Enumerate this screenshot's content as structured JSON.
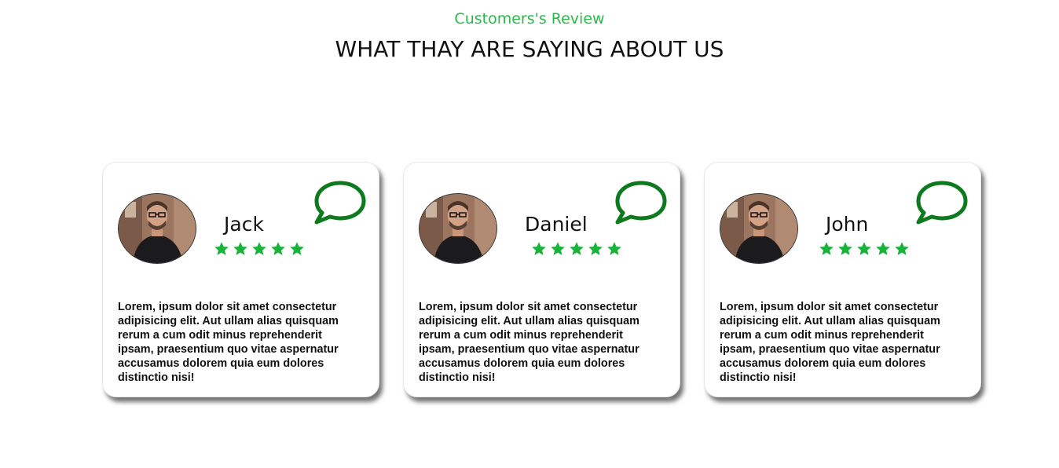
{
  "header": {
    "subtitle": "Customers's Review",
    "title": "WHAT THAY ARE SAYING ABOUT US"
  },
  "colors": {
    "accent": "#2ab84a",
    "icon_green": "#0e7a1e",
    "star_green": "#19b33a"
  },
  "reviews": [
    {
      "name": "Jack",
      "rating": 5,
      "text": "Lorem, ipsum dolor sit amet consectetur adipisicing elit. Aut ullam alias quisquam rerum a cum odit minus reprehenderit ipsam, praesentium quo vitae aspernatur accusamus dolorem quia eum dolores distinctio nisi!",
      "avatar": "man-with-glasses-photo",
      "icon": "chat-bubble-icon"
    },
    {
      "name": "Daniel",
      "rating": 5,
      "text": "Lorem, ipsum dolor sit amet consectetur adipisicing elit. Aut ullam alias quisquam rerum a cum odit minus reprehenderit ipsam, praesentium quo vitae aspernatur accusamus dolorem quia eum dolores distinctio nisi!",
      "avatar": "man-with-glasses-photo",
      "icon": "chat-bubble-icon"
    },
    {
      "name": "John",
      "rating": 5,
      "text": "Lorem, ipsum dolor sit amet consectetur adipisicing elit. Aut ullam alias quisquam rerum a cum odit minus reprehenderit ipsam, praesentium quo vitae aspernatur accusamus dolorem quia eum dolores distinctio nisi!",
      "avatar": "man-with-glasses-photo",
      "icon": "chat-bubble-icon"
    }
  ]
}
